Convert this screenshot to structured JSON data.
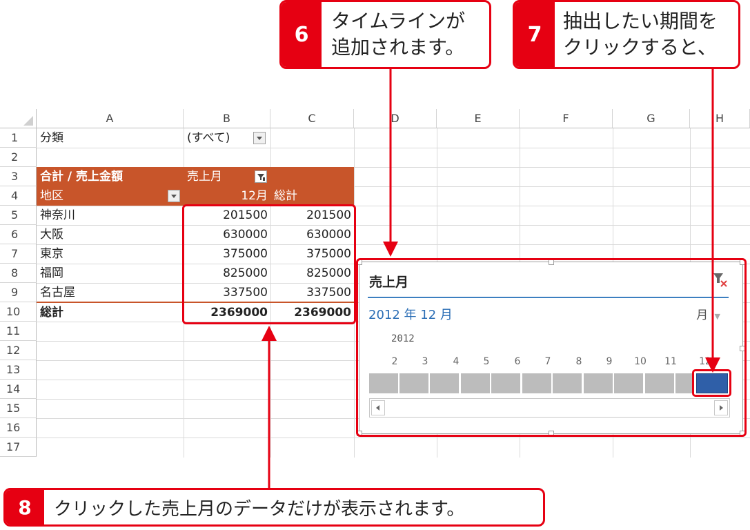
{
  "callouts": [
    {
      "num": "6",
      "lines": [
        "タイムラインが",
        "追加されます。"
      ]
    },
    {
      "num": "7",
      "lines": [
        "抽出したい期間を",
        "クリックすると、"
      ]
    },
    {
      "num": "8",
      "lines": [
        "クリックした売上月のデータだけが表示されます。"
      ]
    }
  ],
  "columns": [
    "A",
    "B",
    "C",
    "D",
    "E",
    "F",
    "G",
    "H"
  ],
  "rows": [
    "1",
    "2",
    "3",
    "4",
    "5",
    "6",
    "7",
    "8",
    "9",
    "10",
    "11",
    "12",
    "13",
    "14",
    "15",
    "16",
    "17"
  ],
  "pivot": {
    "filter_label": "分類",
    "filter_value": "(すべて)",
    "header_values": "合計 / 売上金額",
    "header_cols": "売上月",
    "header_rows": "地区",
    "header_month": "12月",
    "header_total": "総計",
    "data": [
      {
        "area": "神奈川",
        "month": "201500",
        "total": "201500"
      },
      {
        "area": "大阪",
        "month": "630000",
        "total": "630000"
      },
      {
        "area": "東京",
        "month": "375000",
        "total": "375000"
      },
      {
        "area": "福岡",
        "month": "825000",
        "total": "825000"
      },
      {
        "area": "名古屋",
        "month": "337500",
        "total": "337500"
      }
    ],
    "grand_label": "総計",
    "grand_month": "2369000",
    "grand_total": "2369000"
  },
  "timeline": {
    "title": "売上月",
    "selection": "2012 年 12 月",
    "level": "月",
    "year": "2012",
    "months": [
      "2",
      "3",
      "4",
      "5",
      "6",
      "7",
      "8",
      "9",
      "10",
      "11",
      "12"
    ],
    "selected_month": "12"
  },
  "colors": {
    "accent": "#e60012",
    "pivot_header": "#c8552a",
    "timeline_selected": "#2f5fa8",
    "timeline_bar": "#bcbcbc",
    "timeline_line": "#3c7fc0"
  }
}
